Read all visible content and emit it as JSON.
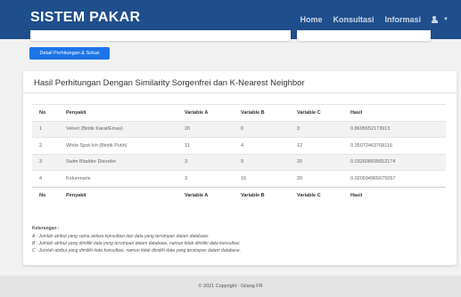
{
  "navbar": {
    "brand": "SISTEM PAKAR",
    "links": [
      "Home",
      "Konsultasi",
      "Informasi"
    ],
    "user_icon": "user-icon",
    "caret_icon": "caret-down-icon"
  },
  "detail_button": "Detail Perhitungan & Solusi",
  "results": {
    "title": "Hasil Perhitungan Dengan Similarity Sorgenfrei dan K-Nearest Neighbor",
    "headers": [
      "No",
      "Penyakit",
      "Variable A",
      "Variable B",
      "Variable C",
      "Hasil"
    ],
    "rows": [
      [
        "1",
        "Velvet (Bintik Karat/Emas)",
        "20",
        "0",
        "3",
        "0.8695652173913"
      ],
      [
        "2",
        "White Spot Ich (Bintik Putih)",
        "11",
        "4",
        "12",
        "0.35072463768116"
      ],
      [
        "3",
        "Swim Bladder Disorder",
        "3",
        "9",
        "20",
        "0.032608695652174"
      ],
      [
        "4",
        "Kolumnaris",
        "3",
        "16",
        "20",
        "0.020594965675057"
      ]
    ],
    "footer_headers": [
      "No",
      "Penyakit",
      "Variable A",
      "Variable B",
      "Variable C",
      "Hasil"
    ]
  },
  "notes": {
    "title": "Keterangan :",
    "lines": [
      "A : Jumlah atribut yang sama antara konsultasi dan data yang tersimpan dalam database.",
      "B : Jumlah atribut yang dimiliki data yang tersimpan dalam database, namun tidak dimiliki data konsultasi.",
      "C : Jumlah atribut yang dimiliki data konsultasi, namun tidak dimiliki data yang tersimpan dalam database."
    ]
  },
  "footer": "© 2021 Copyright : Gilang FR",
  "colors": {
    "navbar": "#1f4e8c",
    "button": "#1d74e8"
  }
}
